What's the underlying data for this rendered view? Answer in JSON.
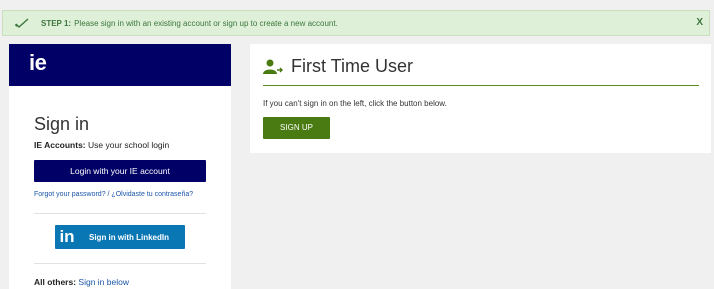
{
  "alert": {
    "step_label": "STEP 1:",
    "message": "Please sign in with an existing account or sign up to create a new account.",
    "close_label": "X"
  },
  "left_panel": {
    "logo_text": "ie",
    "title": "Sign in",
    "accounts_label": "IE Accounts:",
    "accounts_text": "Use your school login",
    "login_button": "Login with your IE account",
    "forgot_link": "Forgot your password? / ¿Olvidaste tu contraseña?",
    "linkedin_icon_text": "in",
    "linkedin_button": "Sign in with LinkedIn",
    "others_label": "All others:",
    "others_link": "Sign in below"
  },
  "right_panel": {
    "title": "First Time User",
    "description": "If you can't sign in on the left, click the button below.",
    "signup_button": "SIGN UP"
  },
  "colors": {
    "brand_navy": "#000066",
    "alert_bg": "#dff0d8",
    "alert_text": "#3c763d",
    "linkedin_blue": "#0a77b5",
    "signup_green": "#4a7a12"
  },
  "icons": {
    "alert": "check-icon",
    "first_time_user": "user-add-icon",
    "linkedin": "linkedin-icon"
  }
}
